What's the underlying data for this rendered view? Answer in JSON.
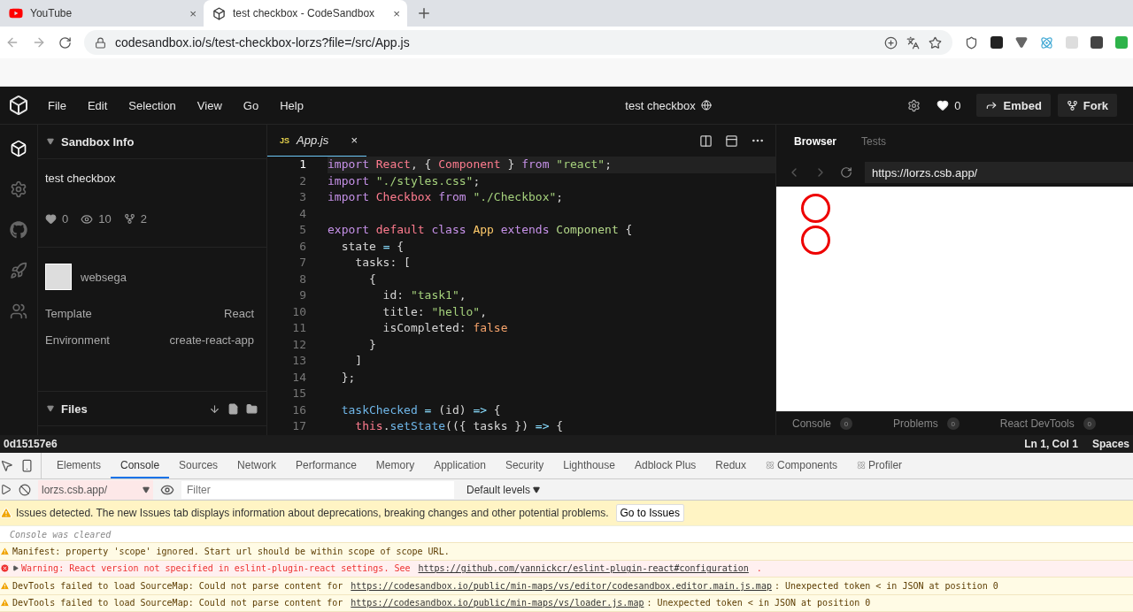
{
  "browser": {
    "tabs": [
      {
        "title": "YouTube",
        "selected": false,
        "close": "×"
      },
      {
        "title": "test checkbox - CodeSandbox",
        "selected": true,
        "close": "×"
      }
    ],
    "url": "codesandbox.io/s/test-checkbox-lorzs?file=/src/App.js"
  },
  "header": {
    "menu": [
      "File",
      "Edit",
      "Selection",
      "View",
      "Go",
      "Help"
    ],
    "title": "test checkbox",
    "likes": "0",
    "buttons": [
      {
        "label": "Embed",
        "kind": "embed"
      },
      {
        "label": "Fork",
        "kind": "fork"
      }
    ]
  },
  "activity_bar": [
    {
      "selected": true
    },
    {
      "selected": false
    },
    {
      "selected": false
    },
    {
      "selected": false
    },
    {
      "selected": false
    }
  ],
  "sidebar": {
    "section": "Sandbox Info",
    "name": "test checkbox",
    "stats": {
      "likes": "0",
      "views": "10",
      "forks": "2"
    },
    "author": "websega",
    "details": [
      {
        "label": "Template",
        "value": "React"
      },
      {
        "label": "Environment",
        "value": "create-react-app"
      }
    ],
    "files_section": "Files"
  },
  "editor": {
    "tab": {
      "badge": "JS",
      "file": "App.js",
      "close": "×"
    },
    "lines": [
      {
        "number": "1",
        "current": true,
        "tokens": [
          {
            "kind": "kw",
            "text": "import "
          },
          {
            "kind": "name",
            "text": "React"
          },
          {
            "kind": "plain",
            "text": ", { "
          },
          {
            "kind": "name",
            "text": "Component"
          },
          {
            "kind": "plain",
            "text": " } "
          },
          {
            "kind": "kw",
            "text": "from "
          },
          {
            "kind": "str",
            "text": "\"react\""
          },
          {
            "kind": "plain",
            "text": ";"
          }
        ]
      },
      {
        "number": "2",
        "current": false,
        "tokens": [
          {
            "kind": "kw",
            "text": "import "
          },
          {
            "kind": "str",
            "text": "\"./styles.css\""
          },
          {
            "kind": "plain",
            "text": ";"
          }
        ]
      },
      {
        "number": "3",
        "current": false,
        "tokens": [
          {
            "kind": "kw",
            "text": "import "
          },
          {
            "kind": "name",
            "text": "Checkbox "
          },
          {
            "kind": "kw",
            "text": "from "
          },
          {
            "kind": "str",
            "text": "\"./Checkbox\""
          },
          {
            "kind": "plain",
            "text": ";"
          }
        ]
      },
      {
        "number": "4",
        "current": false
      },
      {
        "number": "5",
        "current": false,
        "tokens": [
          {
            "kind": "kw",
            "text": "export "
          },
          {
            "kind": "name",
            "text": "default "
          },
          {
            "kind": "kw",
            "text": "class "
          },
          {
            "kind": "cls",
            "text": "App "
          },
          {
            "kind": "kw",
            "text": "extends "
          },
          {
            "kind": "type",
            "text": "Component"
          },
          {
            "kind": "plain",
            "text": " {"
          }
        ]
      },
      {
        "number": "6",
        "current": false,
        "tokens": [
          {
            "kind": "plain",
            "text": "  state "
          },
          {
            "kind": "op",
            "text": "="
          },
          {
            "kind": "plain",
            "text": " {"
          }
        ]
      },
      {
        "number": "7",
        "current": false,
        "tokens": [
          {
            "kind": "plain",
            "text": "    tasks: ["
          }
        ]
      },
      {
        "number": "8",
        "current": false,
        "tokens": [
          {
            "kind": "plain",
            "text": "      {"
          }
        ]
      },
      {
        "number": "9",
        "current": false,
        "tokens": [
          {
            "kind": "plain",
            "text": "        id: "
          },
          {
            "kind": "str",
            "text": "\"task1\""
          },
          {
            "kind": "plain",
            "text": ","
          }
        ]
      },
      {
        "number": "10",
        "current": false,
        "tokens": [
          {
            "kind": "plain",
            "text": "        title: "
          },
          {
            "kind": "str",
            "text": "\"hello\""
          },
          {
            "kind": "plain",
            "text": ","
          }
        ]
      },
      {
        "number": "11",
        "current": false,
        "tokens": [
          {
            "kind": "plain",
            "text": "        isCompleted: "
          },
          {
            "kind": "bool",
            "text": "false"
          }
        ]
      },
      {
        "number": "12",
        "current": false,
        "tokens": [
          {
            "kind": "plain",
            "text": "      }"
          }
        ]
      },
      {
        "number": "13",
        "current": false,
        "tokens": [
          {
            "kind": "plain",
            "text": "    ]"
          }
        ]
      },
      {
        "number": "14",
        "current": false,
        "tokens": [
          {
            "kind": "plain",
            "text": "  };"
          }
        ]
      },
      {
        "number": "15",
        "current": false
      },
      {
        "number": "16",
        "current": false,
        "tokens": [
          {
            "kind": "fn",
            "text": "  taskChecked "
          },
          {
            "kind": "op",
            "text": "="
          },
          {
            "kind": "plain",
            "text": " (id) "
          },
          {
            "kind": "op",
            "text": "=>"
          },
          {
            "kind": "plain",
            "text": " {"
          }
        ]
      },
      {
        "number": "17",
        "current": false,
        "tokens": [
          {
            "kind": "name",
            "text": "    this"
          },
          {
            "kind": "plain",
            "text": "."
          },
          {
            "kind": "fn",
            "text": "setState"
          },
          {
            "kind": "plain",
            "text": "(({ tasks }) "
          },
          {
            "kind": "op",
            "text": "=>"
          },
          {
            "kind": "plain",
            "text": " {"
          }
        ]
      }
    ]
  },
  "preview": {
    "tabs": [
      {
        "label": "Browser",
        "selected": true
      },
      {
        "label": "Tests",
        "selected": false
      }
    ],
    "url": "https://lorzs.csb.app/",
    "checkboxes": [
      {
        "checked": false
      },
      {
        "checked": false
      }
    ],
    "bottom_tabs": [
      {
        "label": "Console",
        "count": "0"
      },
      {
        "label": "Problems",
        "count": "0"
      },
      {
        "label": "React DevTools",
        "count": "0"
      }
    ]
  },
  "status_bar": {
    "commit": "0d15157e6",
    "position": "Ln 1, Col 1",
    "indent": "Spaces"
  },
  "devtools": {
    "tabs": [
      {
        "label": "Elements",
        "selected": false,
        "react": false
      },
      {
        "label": "Console",
        "selected": true,
        "react": false
      },
      {
        "label": "Sources",
        "selected": false,
        "react": false
      },
      {
        "label": "Network",
        "selected": false,
        "react": false
      },
      {
        "label": "Performance",
        "selected": false,
        "react": false
      },
      {
        "label": "Memory",
        "selected": false,
        "react": false
      },
      {
        "label": "Application",
        "selected": false,
        "react": false
      },
      {
        "label": "Security",
        "selected": false,
        "react": false
      },
      {
        "label": "Lighthouse",
        "selected": false,
        "react": false
      },
      {
        "label": "Adblock Plus",
        "selected": false,
        "react": false
      },
      {
        "label": "Redux",
        "selected": false,
        "react": false
      },
      {
        "label": "Components",
        "selected": false,
        "react": true
      },
      {
        "label": "Profiler",
        "selected": false,
        "react": true
      }
    ],
    "context": "lorzs.csb.app/",
    "filter_placeholder": "Filter",
    "levels": "Default levels",
    "issues": {
      "text": "Issues detected. The new Issues tab displays information about deprecations, breaking changes and other potential problems.",
      "button": "Go to Issues"
    },
    "messages": [
      {
        "kind": "info",
        "expandable": false,
        "parts": [
          {
            "kind": "text",
            "text": "Console was cleared"
          }
        ]
      },
      {
        "kind": "warning",
        "expandable": false,
        "parts": [
          {
            "kind": "text",
            "text": "Manifest: property 'scope' ignored. Start url should be within scope of scope URL."
          }
        ]
      },
      {
        "kind": "error",
        "expandable": true,
        "parts": [
          {
            "kind": "text",
            "text": "Warning: React version not specified in eslint-plugin-react settings. See "
          },
          {
            "kind": "link",
            "text": "https://github.com/yannickcr/eslint-plugin-react#configuration"
          },
          {
            "kind": "text",
            "text": " ."
          }
        ]
      },
      {
        "kind": "warning",
        "expandable": false,
        "parts": [
          {
            "kind": "text",
            "text": "DevTools failed to load SourceMap: Could not parse content for "
          },
          {
            "kind": "link",
            "text": "https://codesandbox.io/public/min-maps/vs/editor/codesandbox.editor.main.js.map"
          },
          {
            "kind": "text",
            "text": ": Unexpected token < in JSON at position 0"
          }
        ]
      },
      {
        "kind": "warning",
        "expandable": false,
        "parts": [
          {
            "kind": "text",
            "text": "DevTools failed to load SourceMap: Could not parse content for "
          },
          {
            "kind": "link",
            "text": "https://codesandbox.io/public/min-maps/vs/loader.js.map"
          },
          {
            "kind": "text",
            "text": ": Unexpected token < in JSON at position 0"
          }
        ]
      }
    ]
  }
}
